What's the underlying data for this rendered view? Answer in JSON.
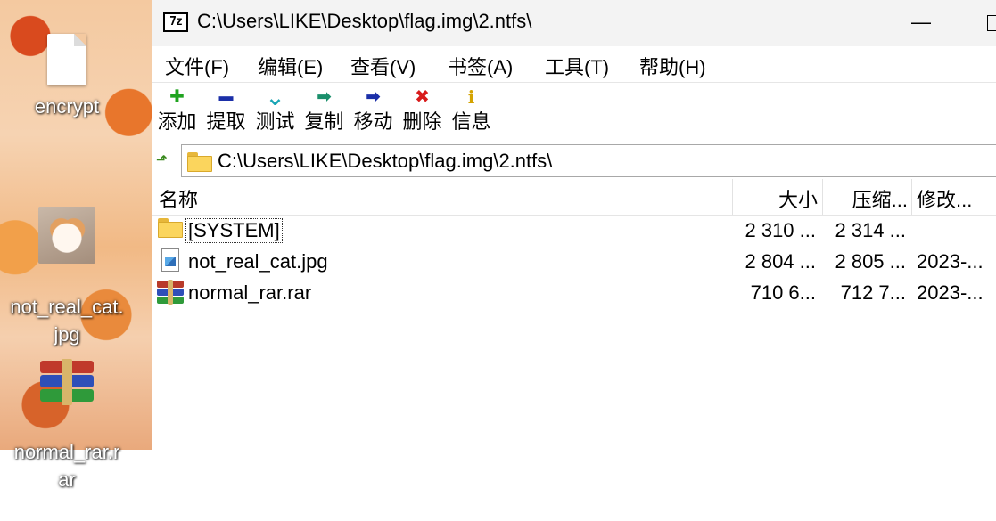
{
  "desktop": {
    "icons": [
      {
        "label": "encrypt",
        "icon": "blank-file-icon"
      },
      {
        "label": "not_real_cat.\njpg",
        "icon": "cat-photo-thumbnail"
      },
      {
        "label": "normal_rar.r\nar",
        "icon": "winrar-archive-icon"
      }
    ]
  },
  "window": {
    "logo": "7z",
    "title": "C:\\Users\\LIKE\\Desktop\\flag.img\\2.ntfs\\",
    "minimize_glyph": "—"
  },
  "menu": [
    "文件(F)",
    "编辑(E)",
    "查看(V)",
    "书签(A)",
    "工具(T)",
    "帮助(H)"
  ],
  "toolbar": [
    {
      "label": "添加",
      "icon": "add-icon",
      "glyph": "✚",
      "color": "#1fa31f"
    },
    {
      "label": "提取",
      "icon": "extract-icon",
      "glyph": "▬",
      "color": "#1b2fa8"
    },
    {
      "label": "测试",
      "icon": "test-icon",
      "glyph": "⌄",
      "color": "#19a5b5"
    },
    {
      "label": "复制",
      "icon": "copy-icon",
      "glyph": "➡",
      "color": "#1a8f6b"
    },
    {
      "label": "移动",
      "icon": "move-icon",
      "glyph": "➡",
      "color": "#1b2fa8"
    },
    {
      "label": "删除",
      "icon": "delete-icon",
      "glyph": "✖",
      "color": "#d81b1b"
    },
    {
      "label": "信息",
      "icon": "info-icon",
      "glyph": "i",
      "color": "#d4a300"
    }
  ],
  "address": {
    "path": "C:\\Users\\LIKE\\Desktop\\flag.img\\2.ntfs\\"
  },
  "columns": {
    "name": "名称",
    "size": "大小",
    "packed": "压缩...",
    "modified": "修改..."
  },
  "files": [
    {
      "name": "[SYSTEM]",
      "type": "folder",
      "size": "2 310 ...",
      "packed": "2 314 ...",
      "modified": ""
    },
    {
      "name": "not_real_cat.jpg",
      "type": "image",
      "size": "2 804 ...",
      "packed": "2 805 ...",
      "modified": "2023-..."
    },
    {
      "name": "normal_rar.rar",
      "type": "rar",
      "size": "710 6...",
      "packed": "712 7...",
      "modified": "2023-..."
    }
  ]
}
